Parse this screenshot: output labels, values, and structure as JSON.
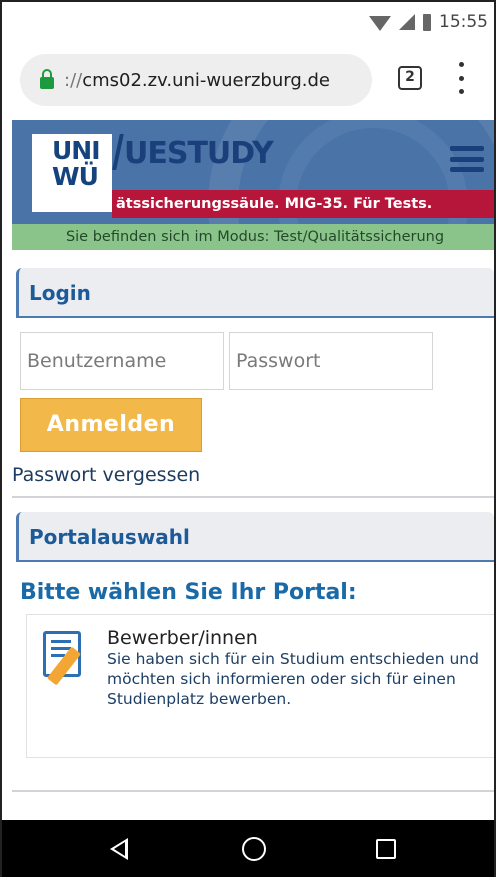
{
  "statusbar": {
    "time": "15:55"
  },
  "browser": {
    "url_prefix": "://",
    "url_host": "cms02.zv.uni-wuerzburg.de",
    "tab_count": "2",
    "icons": [
      "lock-icon",
      "tabs-icon",
      "overflow-menu-icon"
    ]
  },
  "header": {
    "logo_line1": "UNI",
    "logo_line2": "WÜ",
    "brand": "UESTUDY",
    "notice": "ätssicherungssäule. MIG-35. Für Tests.",
    "mode": "Sie befinden sich im Modus: Test/Qualitätssicherung"
  },
  "login": {
    "title": "Login",
    "username_placeholder": "Benutzername",
    "password_placeholder": "Passwort",
    "submit_label": "Anmelden",
    "forgot_label": "Passwort vergessen"
  },
  "portal": {
    "title": "Portalauswahl",
    "prompt": "Bitte wählen Sie Ihr Portal:",
    "cards": [
      {
        "title": "Bewerber/innen",
        "description": "Sie haben sich für ein Studium entschieden und möchten sich informieren oder sich für einen Studienplatz bewerben.",
        "icon": "application-form-icon"
      }
    ]
  },
  "colors": {
    "header_blue": "#4a73a8",
    "notice_red": "#b5163a",
    "mode_green": "#8bc48a",
    "login_button": "#f3b84a",
    "heading_blue": "#1c5a98"
  }
}
